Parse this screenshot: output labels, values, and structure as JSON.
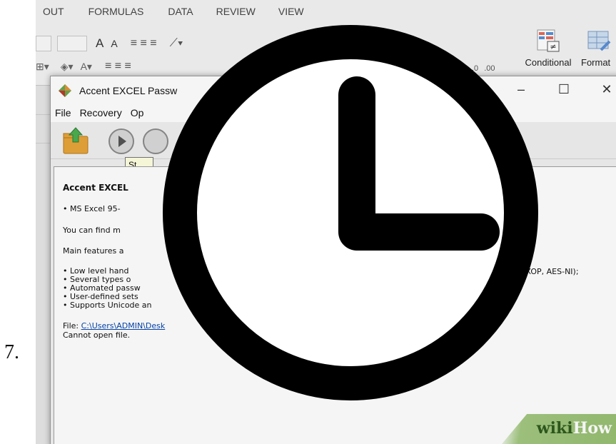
{
  "step_number": "7.",
  "ribbon": {
    "tabs": [
      "OUT",
      "FORMULAS",
      "DATA",
      "REVIEW",
      "VIEW"
    ],
    "font_size_glyphs": [
      "A",
      "A"
    ],
    "conditional_label": "Conditional",
    "format_label": "Format"
  },
  "dialog": {
    "title": "Accent EXCEL Passw",
    "controls": {
      "minimize": "–",
      "maximize": "☐",
      "close": "✕"
    },
    "menu": [
      "File",
      "Recovery",
      "Op"
    ],
    "tooltip": "St",
    "content": {
      "heading": "Accent EXCEL",
      "line_1": "• MS Excel 95-",
      "line_2": "You can find m",
      "line_3": "Main features a",
      "features": [
        "• Low level hand",
        "• Several types o",
        "• Automated passw",
        "• User-defined sets",
        "• Supports Unicode an"
      ],
      "features_right": "X2, XOP, AES-NI);",
      "file_label": "File: ",
      "file_path": "C:\\Users\\ADMIN\\Desk",
      "status": "Cannot open file."
    }
  },
  "watermark": {
    "wiki": "wiki",
    "how": "How"
  },
  "icons": {
    "overlay": "clock-icon",
    "app": "diamond-app-icon",
    "open": "folder-open-icon",
    "start": "play-icon"
  },
  "colors": {
    "clock": "#000000",
    "clock_face": "#ffffff",
    "watermark_green": "#9ec47a",
    "link": "#0645ad"
  }
}
